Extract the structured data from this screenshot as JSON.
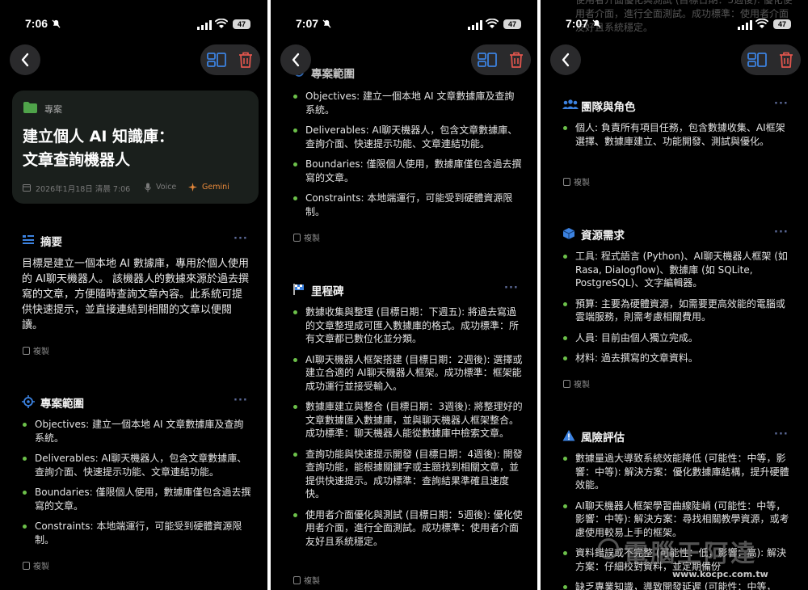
{
  "status": {
    "time1": "7:06",
    "time2": "7:07",
    "time3": "7:07",
    "battery": "47"
  },
  "card": {
    "tag": "專案",
    "title": "建立個人 AI 知識庫：\n文章查詢機器人",
    "date": "2026年1月18日 清晨 7:06",
    "voice": "Voice",
    "source": "Gemini"
  },
  "summary": {
    "title": "摘要",
    "text": "目標是建立一個本地 AI 數據庫，專用於個人使用的 AI聊天機器人。 該機器人的數據來源於過去撰寫的文章，方便隨時查詢文章內容。此系統可提供快速提示，並直接連結到相關的文章以便閱讀。",
    "copy": "複製"
  },
  "scope": {
    "title": "專案範圍",
    "items": [
      "Objectives: 建立一個本地 AI 文章數據庫及查詢系統。",
      "Deliverables: AI聊天機器人，包含文章數據庫、查詢介面、快速提示功能、文章連結功能。",
      "Boundaries: 僅限個人使用，數據庫僅包含過去撰寫的文章。",
      "Constraints: 本地端運行，可能受到硬體資源限制。"
    ],
    "copy": "複製"
  },
  "milestones": {
    "title": "里程碑",
    "items": [
      "數據收集與整理 (目標日期：下週五): 將過去寫過的文章整理成可匯入數據庫的格式。成功標準：所有文章都已數位化並分類。",
      "AI聊天機器人框架搭建 (目標日期：2週後): 選擇或建立合適的 AI聊天機器人框架。成功標準：框架能成功運行並接受輸入。",
      "數據庫建立與整合 (目標日期：3週後): 將整理好的文章數據匯入數據庫，並與聊天機器人框架整合。成功標準：聊天機器人能從數據庫中檢索文章。",
      "查詢功能與快速提示開發 (目標日期：4週後): 開發查詢功能，能根據關鍵字或主題找到相關文章，並提供快速提示。成功標準：查詢結果準確且速度快。",
      "使用者介面優化與測試 (目標日期：5週後): 優化使用者介面，進行全面測試。成功標準：使用者介面友好且系統穩定。"
    ],
    "copy": "複製",
    "p3_top_fragment": "使用者介面優化與測試 (目標日期：5週後): 優化使用者介面，進行全面測試。成功標準：使用者介面友好且系統穩定。"
  },
  "team": {
    "title": "團隊與角色",
    "items": [
      "個人: 負責所有項目任務，包含數據收集、AI框架選擇、數據庫建立、功能開發、測試與優化。"
    ],
    "copy": "複製"
  },
  "resources": {
    "title": "資源需求",
    "items": [
      "工具: 程式語言 (Python)、AI聊天機器人框架 (如 Rasa, Dialogflow)、數據庫 (如 SQLite, PostgreSQL)、文字編輯器。",
      "預算: 主要為硬體資源，如需要更高效能的電腦或雲端服務，則需考慮相關費用。",
      "人員: 目前由個人獨立完成。",
      "材料: 過去撰寫的文章資料。"
    ],
    "copy": "複製"
  },
  "risks": {
    "title": "風險評估",
    "items": [
      "數據量過大導致系統效能降低 (可能性：中等，影響：中等): 解決方案：優化數據庫結構，提升硬體效能。",
      "AI聊天機器人框架學習曲線陡峭 (可能性：中等，影響：中等): 解決方案：尋找相關教學資源，或考慮使用較易上手的框架。",
      "資料錯誤或不完整 (可能性：低，影響：高): 解決方案：仔細校對資料，並定期備份",
      "缺乏專業知識，導致開發延遲 (可能性：中等，"
    ]
  },
  "watermark": {
    "brand": "電腦王阿達",
    "url": "www.kocpc.com.tw"
  },
  "colors": {
    "accent": "#6cc04a",
    "blue": "#3c82e0",
    "delete": "#e0554d",
    "dots": "#5d6b9a"
  }
}
